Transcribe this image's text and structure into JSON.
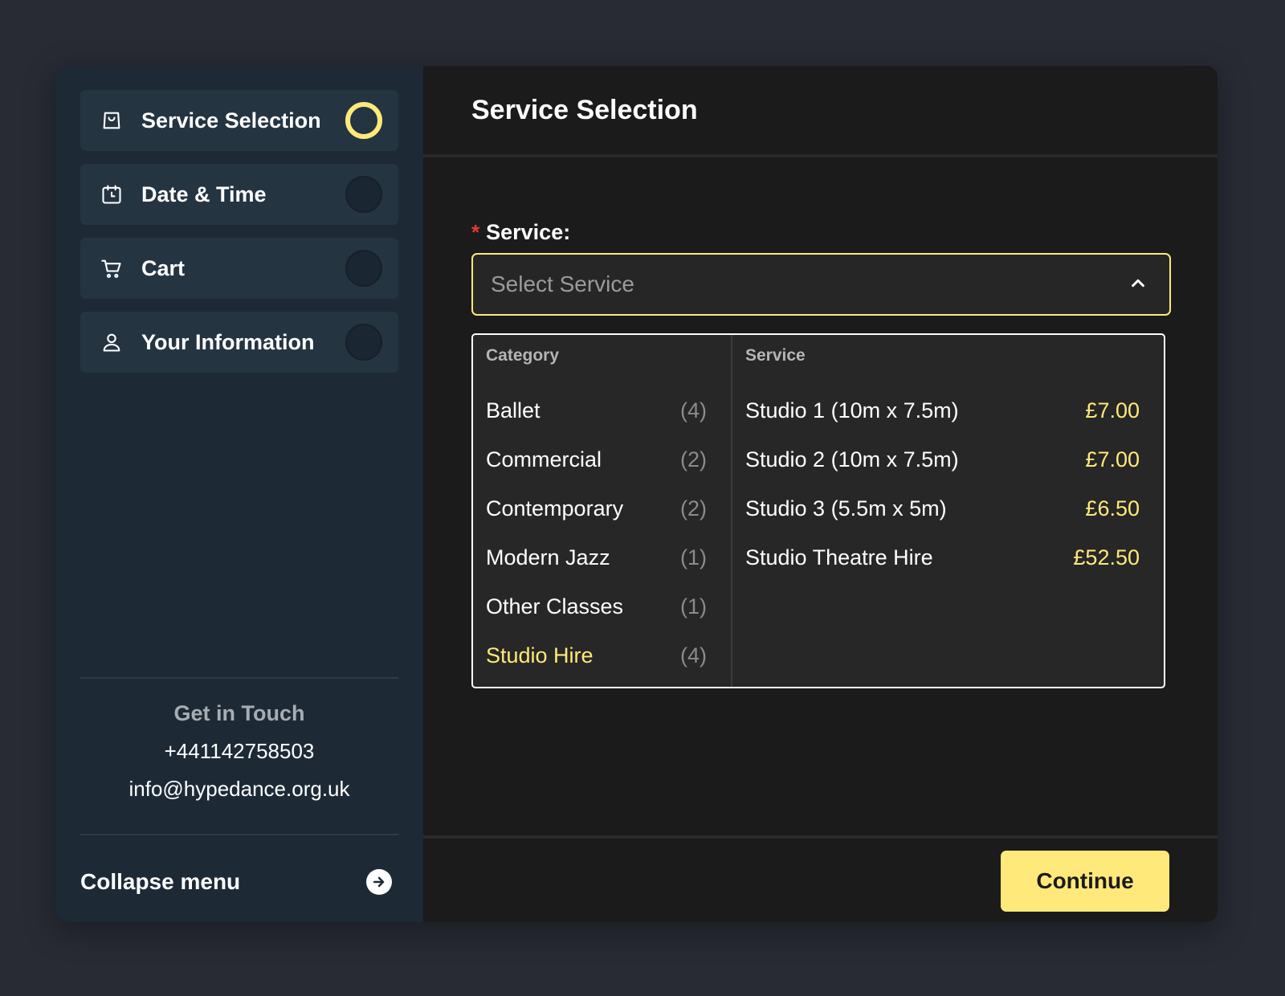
{
  "sidebar": {
    "steps": [
      {
        "label": "Service Selection",
        "icon": "shopping-bag-icon",
        "status": "active"
      },
      {
        "label": "Date & Time",
        "icon": "calendar-icon",
        "status": "pending"
      },
      {
        "label": "Cart",
        "icon": "cart-icon",
        "status": "pending"
      },
      {
        "label": "Your Information",
        "icon": "user-icon",
        "status": "pending"
      }
    ],
    "contact": {
      "title": "Get in Touch",
      "phone": "+441142758503",
      "email": "info@hypedance.org.uk"
    },
    "collapse_label": "Collapse menu"
  },
  "main": {
    "title": "Service Selection",
    "service_field": {
      "required_mark": "*",
      "label": "Service:",
      "placeholder": "Select Service"
    },
    "dropdown": {
      "category_header": "Category",
      "service_header": "Service",
      "categories": [
        {
          "name": "Ballet",
          "count": "(4)",
          "selected": false
        },
        {
          "name": "Commercial",
          "count": "(2)",
          "selected": false
        },
        {
          "name": "Contemporary",
          "count": "(2)",
          "selected": false
        },
        {
          "name": "Modern Jazz",
          "count": "(1)",
          "selected": false
        },
        {
          "name": "Other Classes",
          "count": "(1)",
          "selected": false
        },
        {
          "name": "Studio Hire",
          "count": "(4)",
          "selected": true
        }
      ],
      "services": [
        {
          "name": "Studio 1 (10m x 7.5m)",
          "price": "£7.00"
        },
        {
          "name": "Studio 2 (10m x 7.5m)",
          "price": "£7.00"
        },
        {
          "name": "Studio 3 (5.5m x 5m)",
          "price": "£6.50"
        },
        {
          "name": "Studio Theatre Hire",
          "price": "£52.50"
        }
      ]
    },
    "continue_label": "Continue"
  },
  "colors": {
    "accent": "#ffe97a",
    "sidebar_bg": "#1d2a36",
    "main_bg": "#1b1b1b",
    "required": "#e53935"
  }
}
